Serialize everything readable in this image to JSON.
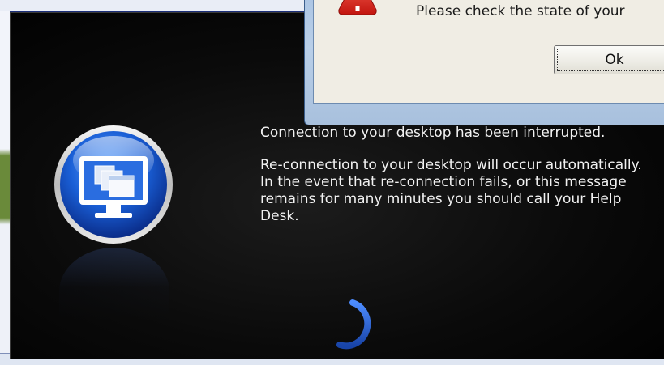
{
  "reconnect_dialog": {
    "message_line1": "Connection to your desktop has been interrupted.",
    "message_line2": "Re-connection to your desktop will occur automatically.  In the event that re-connection fails, or this message remains for many minutes you should call your Help Desk.",
    "icon": "monitor-windows-icon",
    "spinner_icon": "loading-spinner-icon",
    "accent_color": "#1a5fd6",
    "background_color": "#000000"
  },
  "alert_dialog": {
    "message": "Please check the state of your",
    "ok_label": "Ok",
    "icon": "warning-icon",
    "icon_color": "#d42020"
  }
}
